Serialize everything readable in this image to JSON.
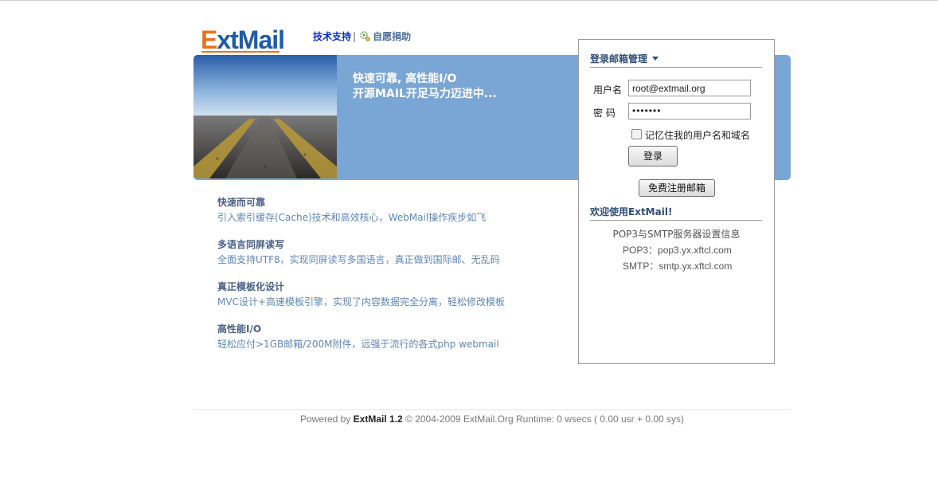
{
  "header": {
    "logo_text_first": "E",
    "logo_text_rest": "xtMail",
    "support_link": "技术支持",
    "separator": "|",
    "donate_link": "自愿捐助",
    "donate_icon": "gear-coins-icon"
  },
  "banner": {
    "line1": "快速可靠, 高性能I/O",
    "line2": "开源MAIL开足马力迈进中...",
    "background_color": "#7aa6d6"
  },
  "features": [
    {
      "title": "快速而可靠",
      "desc": "引入索引缓存(Cache)技术和高效核心，WebMail操作疾步如飞"
    },
    {
      "title": "多语言同屏读写",
      "desc": "全面支持UTF8，实现同屏读写多国语言，真正做到国际邮、无乱码"
    },
    {
      "title": "真正模板化设计",
      "desc": "MVC设计+高速模板引擎，实现了内容数据完全分离，轻松修改模板"
    },
    {
      "title": "高性能I/O",
      "desc": "轻松应付>1GB邮箱/200M附件，远强于流行的各式php webmail"
    }
  ],
  "login": {
    "heading": "登录邮箱管理",
    "username_label": "用户名",
    "username_value": "root@extmail.org",
    "password_label": "密 码",
    "password_value": "•••••••",
    "remember_label": "记忆住我的用户名和域名",
    "login_button": "登录",
    "register_button": "免费注册邮箱",
    "welcome": "欢迎使用ExtMail!",
    "server_info_title": "POP3与SMTP服务器设置信息",
    "pop3_label": "POP3：",
    "pop3_value": "pop3.yx.xftcl.com",
    "smtp_label": "SMTP：",
    "smtp_value": "smtp.yx.xftcl.com"
  },
  "footer": {
    "powered_by": "Powered by ",
    "product": "ExtMail 1.2",
    "rest": " © 2004-2009 ExtMail.Org Runtime: 0 wsecs ( 0.00 usr + 0.00 sys)"
  },
  "colors": {
    "accent_orange": "#e8731a",
    "brand_blue": "#1f5aa6",
    "link_blue": "#0b2ec2",
    "heading_blue": "#2e4d79"
  }
}
